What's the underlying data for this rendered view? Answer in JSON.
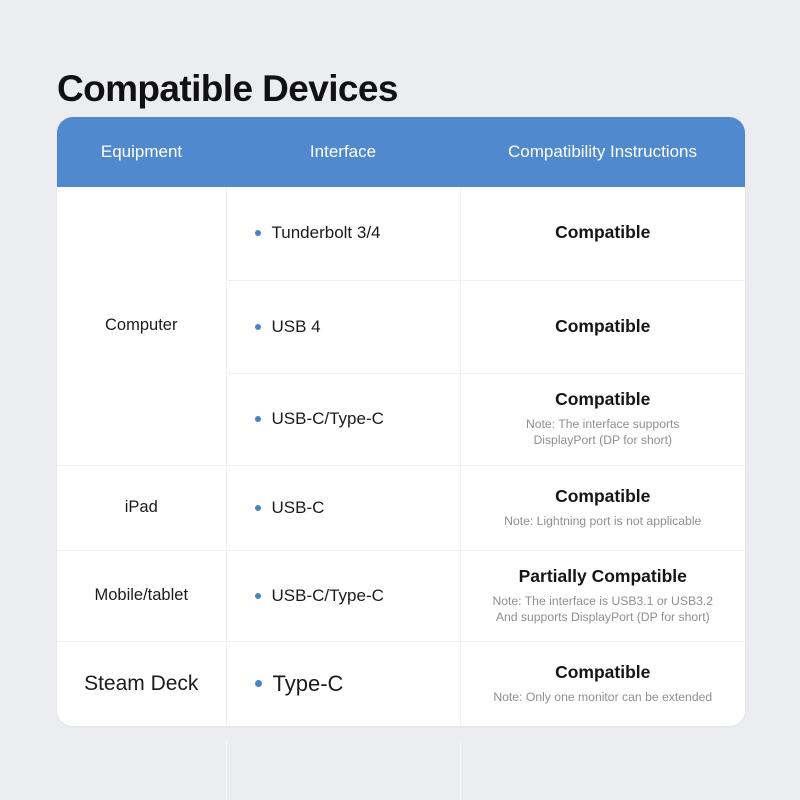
{
  "page": {
    "title": "Compatible Devices",
    "background_color": "#ECEDF1"
  },
  "theme": {
    "header_blue": "#5189CE",
    "bullet_blue": "#4A82C4",
    "note_gray": "#8D8F96",
    "card_white": "#FFFFFF",
    "divider": "#F0F1F4"
  },
  "table": {
    "columns": [
      {
        "key": "equipment",
        "label": "Equipment"
      },
      {
        "key": "interface",
        "label": "Interface"
      },
      {
        "key": "compatibility",
        "label": "Compatibility Instructions"
      }
    ],
    "rows": [
      {
        "equipment": "Computer",
        "equipment_rowspan": 3,
        "interface": "Tunderbolt 3/4",
        "status": "Compatible",
        "note": ""
      },
      {
        "equipment": "",
        "interface": "USB 4",
        "status": "Compatible",
        "note": ""
      },
      {
        "equipment": "",
        "interface": "USB-C/Type-C",
        "status": "Compatible",
        "note": "Note: The interface supports\nDisplayPort (DP for short)"
      },
      {
        "equipment": "iPad",
        "equipment_rowspan": 1,
        "interface": "USB-C",
        "status": "Compatible",
        "note": "Note: Lightning port is not applicable"
      },
      {
        "equipment": "Mobile/tablet",
        "equipment_rowspan": 1,
        "interface": "USB-C/Type-C",
        "status": "Partially Compatible",
        "note": "Note: The interface is USB3.1 or USB3.2\nAnd supports DisplayPort (DP for short)"
      },
      {
        "equipment": "Steam Deck",
        "equipment_rowspan": 1,
        "interface": "Type-C",
        "status": "Compatible",
        "note": "Note: Only one monitor can be extended"
      }
    ]
  }
}
